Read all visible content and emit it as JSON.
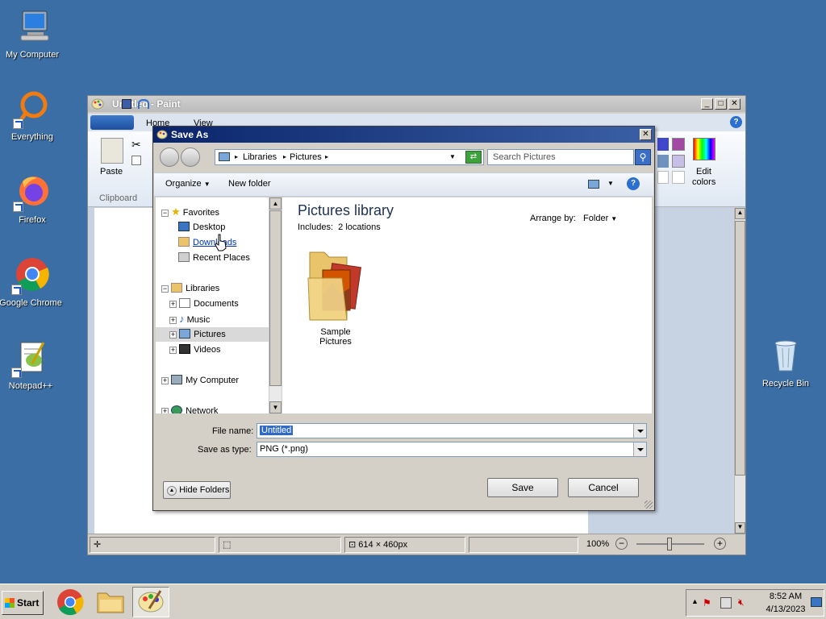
{
  "desktop": {
    "icons": [
      {
        "label": "My Computer",
        "icon": "computer-icon"
      },
      {
        "label": "Everything",
        "icon": "search-ring-icon"
      },
      {
        "label": "Firefox",
        "icon": "firefox-icon"
      },
      {
        "label": "Google Chrome",
        "icon": "chrome-icon"
      },
      {
        "label": "Notepad++",
        "icon": "notepad-plus-icon"
      },
      {
        "label": "Recycle Bin",
        "icon": "recycle-bin-icon"
      }
    ]
  },
  "paint": {
    "title": "Untitled - Paint",
    "tabs": {
      "home": "Home",
      "view": "View"
    },
    "ribbon": {
      "paste": "Paste",
      "clipboard": "Clipboard",
      "edit_colors_1": "Edit",
      "edit_colors_2": "colors"
    },
    "status": {
      "dimensions": "614 × 460px",
      "zoom": "100%"
    }
  },
  "dialog": {
    "title": "Save As",
    "breadcrumb": [
      "Libraries",
      "Pictures"
    ],
    "search_placeholder": "Search Pictures",
    "toolbar": {
      "organize": "Organize",
      "new_folder": "New folder"
    },
    "nav": {
      "favorites": "Favorites",
      "desktop": "Desktop",
      "downloads": "Downloads",
      "recent_places": "Recent Places",
      "libraries": "Libraries",
      "documents": "Documents",
      "music": "Music",
      "pictures": "Pictures",
      "videos": "Videos",
      "my_computer": "My Computer",
      "network": "Network"
    },
    "content": {
      "heading": "Pictures library",
      "includes": "Includes:",
      "locations": "2 locations",
      "arrange_by": "Arrange by:",
      "arrange_value": "Folder",
      "folder_name": "Sample Pictures"
    },
    "file_name_label": "File name:",
    "file_name_value": "Untitled",
    "save_type_label": "Save as type:",
    "save_type_value": "PNG (*.png)",
    "hide_folders": "Hide Folders",
    "save": "Save",
    "cancel": "Cancel"
  },
  "taskbar": {
    "start": "Start",
    "time": "8:52 AM",
    "date": "4/13/2023"
  }
}
